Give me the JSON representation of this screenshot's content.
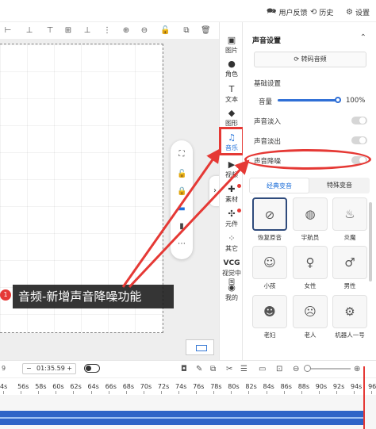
{
  "topbar": {
    "feedback": "用户反馈",
    "history": "历史",
    "settings": "设置"
  },
  "caption": {
    "badge": "1",
    "text": "音频-新增声音降噪功能"
  },
  "rail": {
    "items": [
      {
        "label": "图片",
        "icon": "image-icon"
      },
      {
        "label": "角色",
        "icon": "person-icon"
      },
      {
        "label": "文本",
        "icon": "text-icon"
      },
      {
        "label": "图形",
        "icon": "shape-icon"
      },
      {
        "label": "音乐",
        "icon": "music-icon"
      },
      {
        "label": "视频",
        "icon": "video-icon"
      },
      {
        "label": "素材",
        "icon": "material-icon"
      },
      {
        "label": "元件",
        "icon": "component-icon"
      },
      {
        "label": "其它",
        "icon": "grid-icon"
      },
      {
        "label": "视觉中国",
        "icon": "vcg-icon",
        "logo": "VCG"
      },
      {
        "label": "我的",
        "icon": "user-icon"
      }
    ],
    "active": "音乐"
  },
  "panel": {
    "title": "声音设置",
    "convert_button": "转码音频",
    "basic_settings": "基础设置",
    "volume_label": "音量",
    "volume_value": "100%",
    "volume_fraction": 1.0,
    "fade_in": "声音淡入",
    "fade_out": "声音淡出",
    "denoise": "声音降噪",
    "toggles": {
      "fade_in": false,
      "fade_out": false,
      "denoise": false
    },
    "tabs": [
      "经典变音",
      "特殊变音"
    ],
    "active_tab": "经典变音",
    "voices": [
      {
        "label": "恢复原音",
        "icon": "no-effect-icon"
      },
      {
        "label": "宇航员",
        "icon": "astronaut-icon"
      },
      {
        "label": "炎魔",
        "icon": "flame-icon"
      },
      {
        "label": "小孩",
        "icon": "child-icon"
      },
      {
        "label": "女性",
        "icon": "female-icon"
      },
      {
        "label": "男性",
        "icon": "male-icon"
      },
      {
        "label": "老妇",
        "icon": "old-woman-icon"
      },
      {
        "label": "老人",
        "icon": "old-man-icon"
      },
      {
        "label": "机器人一号",
        "icon": "robot-icon"
      }
    ],
    "active_voice": "恢复原音"
  },
  "timeline": {
    "left_partial": "9",
    "minus": "−",
    "current_time": "01:35.59",
    "plus": "+",
    "ruler_ticks": [
      "4s",
      "56s",
      "58s",
      "60s",
      "62s",
      "64s",
      "66s",
      "68s",
      "70s",
      "72s",
      "74s",
      "76s",
      "78s",
      "80s",
      "82s",
      "84s",
      "86s",
      "88s",
      "90s",
      "92s",
      "94s"
    ],
    "ruler_last": "96s"
  },
  "colors": {
    "accent": "#1e6fd9",
    "annotation_red": "#e53935",
    "clip_blue": "#2e64c7"
  }
}
